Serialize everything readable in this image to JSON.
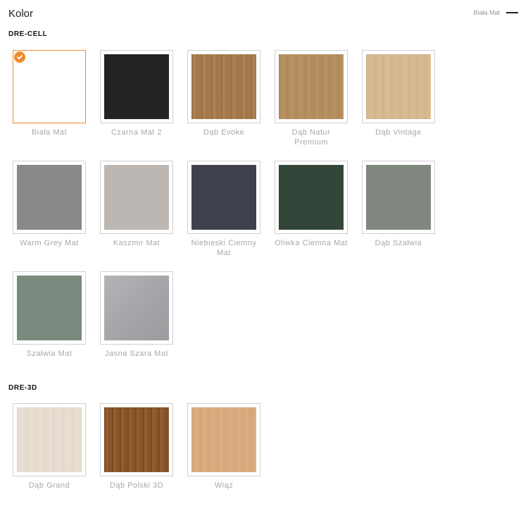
{
  "header": {
    "title": "Kolor",
    "selected_value": "Biała Mat"
  },
  "groups": [
    {
      "title": "DRE-CELL",
      "items": [
        {
          "name": "Biała Mat",
          "selected": true,
          "color": "#ffffff",
          "texture": "none"
        },
        {
          "name": "Czarna Mat 2",
          "selected": false,
          "color": "#252222",
          "texture": "none"
        },
        {
          "name": "Dąb Evoke",
          "selected": false,
          "color": "#a57a4b",
          "texture": "wood-oak"
        },
        {
          "name": "Dąb Natur Premium",
          "selected": false,
          "color": "#b48d5f",
          "texture": "wood-light"
        },
        {
          "name": "Dąb Vintage",
          "selected": false,
          "color": "#d6b88f",
          "texture": "wood-light"
        },
        {
          "name": "Warm Grey Mat",
          "selected": false,
          "color": "#8b8987",
          "texture": "none"
        },
        {
          "name": "Kaszmir Mat",
          "selected": false,
          "color": "#bcb7b2",
          "texture": "none"
        },
        {
          "name": "Niebieski Ciemny Mat",
          "selected": false,
          "color": "#3f424c",
          "texture": "none"
        },
        {
          "name": "Oliwka Ciemna Mat",
          "selected": false,
          "color": "#334639",
          "texture": "none"
        },
        {
          "name": "Dąb Szałwia",
          "selected": false,
          "color": "#80877f",
          "texture": "none"
        },
        {
          "name": "Szałwia Mat",
          "selected": false,
          "color": "#7a8a7e",
          "texture": "none"
        },
        {
          "name": "Jasna Szara Mat",
          "selected": false,
          "color": "#a3a5a8",
          "texture": "gradient"
        }
      ]
    },
    {
      "title": "DRE-3D",
      "items": [
        {
          "name": "Dąb Grand",
          "selected": false,
          "color": "#e6ddd0",
          "texture": "wood-pale"
        },
        {
          "name": "Dąb Polski 3D",
          "selected": false,
          "color": "#8a5426",
          "texture": "wood-dark"
        },
        {
          "name": "Wiąz",
          "selected": false,
          "color": "#d8aa7c",
          "texture": "wood-light"
        }
      ]
    }
  ]
}
